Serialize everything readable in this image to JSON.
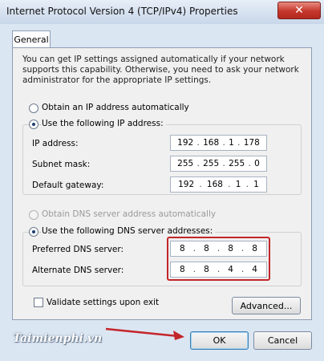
{
  "window": {
    "title": "Internet Protocol Version 4 (TCP/IPv4) Properties",
    "close_icon": "close-icon"
  },
  "tabs": [
    {
      "label": "General"
    }
  ],
  "description": "You can get IP settings assigned automatically if your network supports this capability. Otherwise, you need to ask your network administrator for the appropriate IP settings.",
  "ip_options": {
    "auto_label": "Obtain an IP address automatically",
    "auto_checked": false,
    "manual_label": "Use the following IP address:",
    "manual_checked": true
  },
  "ip_fields": {
    "ip_address": {
      "label": "IP address:",
      "octets": [
        "192",
        "168",
        "1",
        "178"
      ]
    },
    "subnet_mask": {
      "label": "Subnet mask:",
      "octets": [
        "255",
        "255",
        "255",
        "0"
      ]
    },
    "default_gateway": {
      "label": "Default gateway:",
      "octets": [
        "192",
        "168",
        "1",
        "1"
      ]
    }
  },
  "dns_options": {
    "auto_label": "Obtain DNS server address automatically",
    "auto_checked": false,
    "auto_disabled": true,
    "manual_label": "Use the following DNS server addresses:",
    "manual_checked": true
  },
  "dns_fields": {
    "preferred": {
      "label": "Preferred DNS server:",
      "octets": [
        "8",
        "8",
        "8",
        "8"
      ]
    },
    "alternate": {
      "label": "Alternate DNS server:",
      "octets": [
        "8",
        "8",
        "4",
        "4"
      ]
    }
  },
  "validate": {
    "label": "Validate settings upon exit",
    "checked": false
  },
  "buttons": {
    "advanced": "Advanced...",
    "ok": "OK",
    "cancel": "Cancel"
  },
  "watermark": "Taimienphi.vn",
  "colors": {
    "highlight": "#c3262a",
    "close": "#c5362b",
    "frame": "#dbe6f3"
  }
}
